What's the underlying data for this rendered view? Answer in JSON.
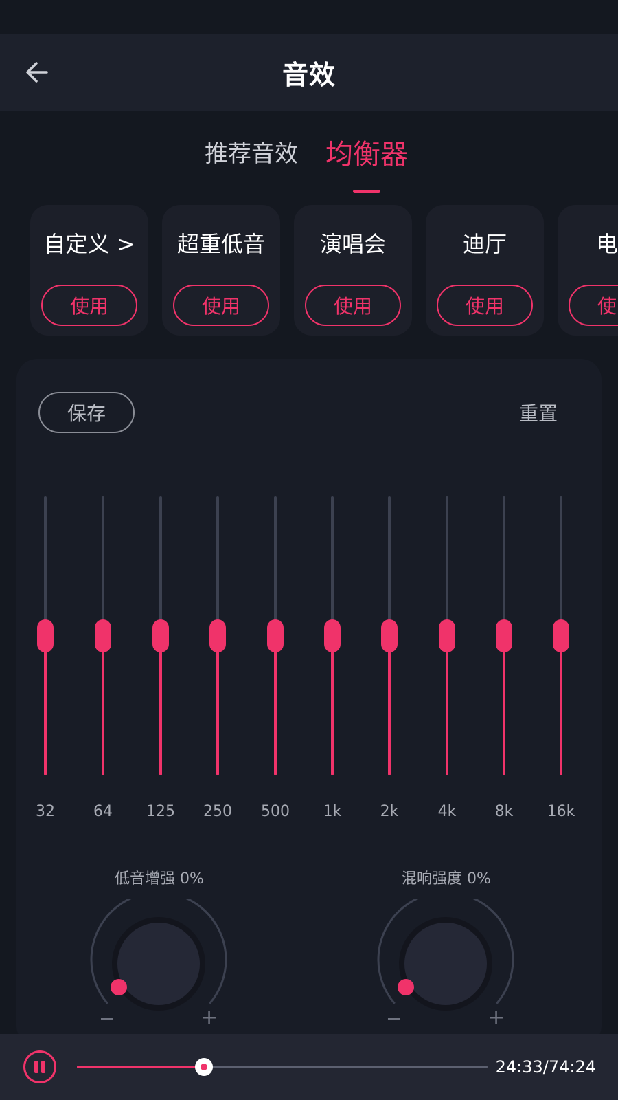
{
  "header": {
    "title": "音效",
    "back_icon": "arrow-left-icon"
  },
  "tabs": [
    {
      "label": "推荐音效",
      "active": false
    },
    {
      "label": "均衡器",
      "active": true
    }
  ],
  "presets": [
    {
      "name": "自定义 >",
      "action": "使用"
    },
    {
      "name": "超重低音",
      "action": "使用"
    },
    {
      "name": "演唱会",
      "action": "使用"
    },
    {
      "name": "迪厅",
      "action": "使用"
    },
    {
      "name": "电",
      "action": "使"
    }
  ],
  "equalizer": {
    "save_label": "保存",
    "reset_label": "重置",
    "bands": [
      {
        "freq": "32",
        "level": 0.5
      },
      {
        "freq": "64",
        "level": 0.5
      },
      {
        "freq": "125",
        "level": 0.5
      },
      {
        "freq": "250",
        "level": 0.5
      },
      {
        "freq": "500",
        "level": 0.5
      },
      {
        "freq": "1k",
        "level": 0.5
      },
      {
        "freq": "2k",
        "level": 0.5
      },
      {
        "freq": "4k",
        "level": 0.5
      },
      {
        "freq": "8k",
        "level": 0.5
      },
      {
        "freq": "16k",
        "level": 0.5
      }
    ],
    "bass_boost": {
      "label": "低音增强 0%",
      "value": 0,
      "minus": "−",
      "plus": "+"
    },
    "reverb": {
      "label": "混响强度 0%",
      "value": 0,
      "minus": "−",
      "plus": "+"
    }
  },
  "player": {
    "state_icon": "pause-icon",
    "progress": 0.31,
    "time": "24:33/74:24"
  },
  "colors": {
    "accent": "#f0336a",
    "background": "#141820",
    "surface": "#1c1f29"
  }
}
